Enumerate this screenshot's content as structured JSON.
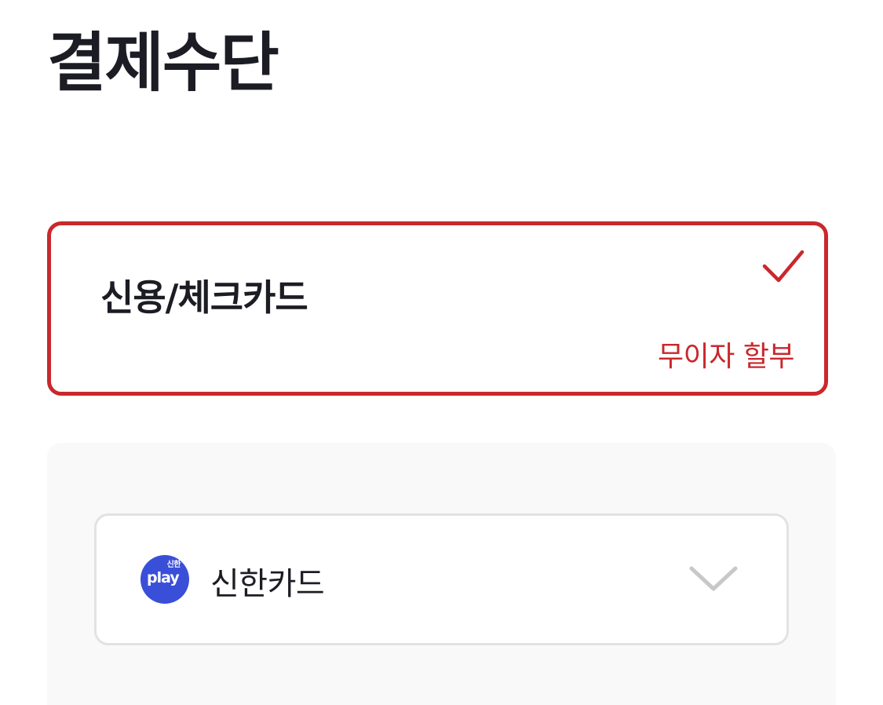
{
  "header": {
    "title": "결제수단"
  },
  "payment_method": {
    "label": "신용/체크카드",
    "badge": "무이자 할부",
    "selected": true,
    "accent_color": "#c9282d",
    "check_icon": "checkmark-icon"
  },
  "card_select": {
    "logo": {
      "top_text": "신한",
      "main_text": "play",
      "color": "#3a4fd8",
      "icon": "shinhan-play-logo"
    },
    "selected_card": "신한카드",
    "dropdown_icon": "chevron-down-icon"
  }
}
